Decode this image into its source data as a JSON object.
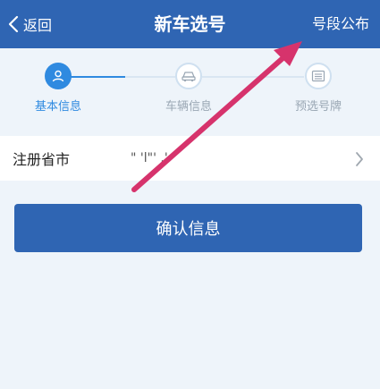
{
  "header": {
    "back_label": "返回",
    "title": "新车选号",
    "announce_label": "号段公布"
  },
  "steps": [
    {
      "label": "基本信息",
      "icon": "user-icon",
      "state": "active"
    },
    {
      "label": "车辆信息",
      "icon": "car-icon",
      "state": "inactive"
    },
    {
      "label": "预选号牌",
      "icon": "plate-icon",
      "state": "inactive"
    }
  ],
  "registration": {
    "label": "注册省市",
    "value": "\" 'l\"' .' "
  },
  "actions": {
    "confirm_label": "确认信息"
  },
  "colors": {
    "header_bg": "#2f65b3",
    "active": "#2f8ae0",
    "annotation_arrow": "#d6336c"
  }
}
